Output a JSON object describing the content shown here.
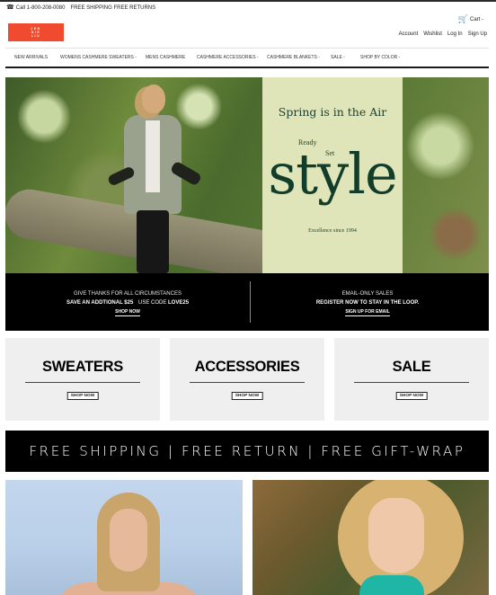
{
  "utility": {
    "phone_icon": "☎",
    "phone": "Call 1-800-208-0080",
    "shipping_notice": "FREE SHIPPING FREE RETURNS"
  },
  "cart": {
    "icon": "cart-icon",
    "label": "Cart -"
  },
  "logo": {
    "line1": "JEN",
    "line2": "NIE",
    "line3": "LIU"
  },
  "account_links": [
    "Account",
    "Wishlist",
    "Log In",
    "Sign Up"
  ],
  "nav": {
    "items": [
      "NEW ARRIVALS",
      "WOMENS CASHMERE SWEATERS -",
      "MENS CASHMERE",
      "CASHMERE ACCESSORIES -",
      "CASHMERE BLANKETS -",
      "SALE -",
      "SHOP BY COLOR -"
    ]
  },
  "hero": {
    "headline": "Spring is in the Air",
    "ready": "Ready",
    "set": "Set",
    "style": "style",
    "tagline": "Excellence since 1994"
  },
  "promo": {
    "left": {
      "line1": "GIVE THANKS FOR ALL CIRCUMSTANCES",
      "line2_a": "SAVE AN ADDTIONAL $25",
      "line2_b": "USE CODE",
      "line2_c": "LOVE25",
      "cta": "SHOP NOW"
    },
    "right": {
      "line1": "EMAIL-ONLY SALES",
      "line2": "REGISTER NOW TO STAY IN THE LOOP.",
      "cta": "SIGN UP FOR EMAIL"
    }
  },
  "categories": [
    {
      "title": "SWEATERS",
      "cta": "SHOP NOW"
    },
    {
      "title": "ACCESSORIES",
      "cta": "SHOP NOW"
    },
    {
      "title": "SALE",
      "cta": "SHOP NOW"
    }
  ],
  "shipping_bar": "FREE SHIPPING  |  FREE RETURN  |  FREE GIFT-WRAP",
  "colors": {
    "logo_bg": "#f04a2f",
    "hero_panel_bg": "#dfe4b9",
    "hero_text": "#123d2a",
    "bar_bg": "#000000",
    "tile_bg": "#efefef"
  }
}
